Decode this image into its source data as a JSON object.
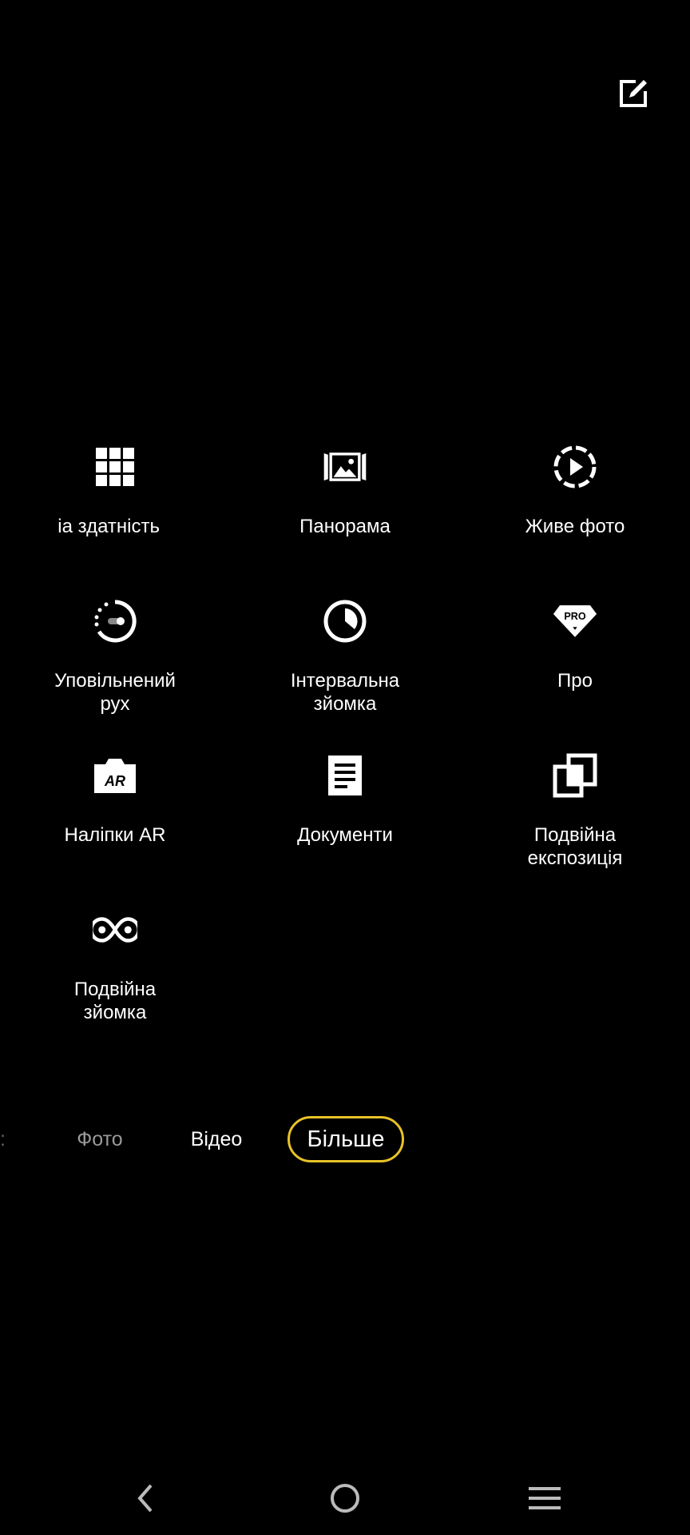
{
  "toolbar": {
    "edit_icon": "edit-icon"
  },
  "modes": [
    {
      "label": "ia здатність",
      "icon": "grid-icon"
    },
    {
      "label": "Панорама",
      "icon": "panorama-icon"
    },
    {
      "label": "Живе фото",
      "icon": "live-photo-icon"
    },
    {
      "label": "Уповільнений\nрух",
      "icon": "slow-motion-icon"
    },
    {
      "label": "Інтервальна\nзйомка",
      "icon": "timelapse-icon"
    },
    {
      "label": "Про",
      "icon": "pro-icon"
    },
    {
      "label": "Наліпки AR",
      "icon": "ar-stickers-icon"
    },
    {
      "label": "Документи",
      "icon": "document-icon"
    },
    {
      "label": "Подвійна\nекспозиція",
      "icon": "double-exposure-icon"
    },
    {
      "label": "Подвійна\nзйомка",
      "icon": "dual-view-icon"
    }
  ],
  "tabs": {
    "photo": "Фото",
    "video": "Відео",
    "more": "Більше"
  },
  "colors": {
    "accent": "#e8c228",
    "background": "#000000",
    "inactive_tab": "#9a9a9a"
  },
  "nav": {
    "back_icon": "back-icon",
    "home_icon": "home-icon",
    "recents_icon": "menu-icon"
  }
}
